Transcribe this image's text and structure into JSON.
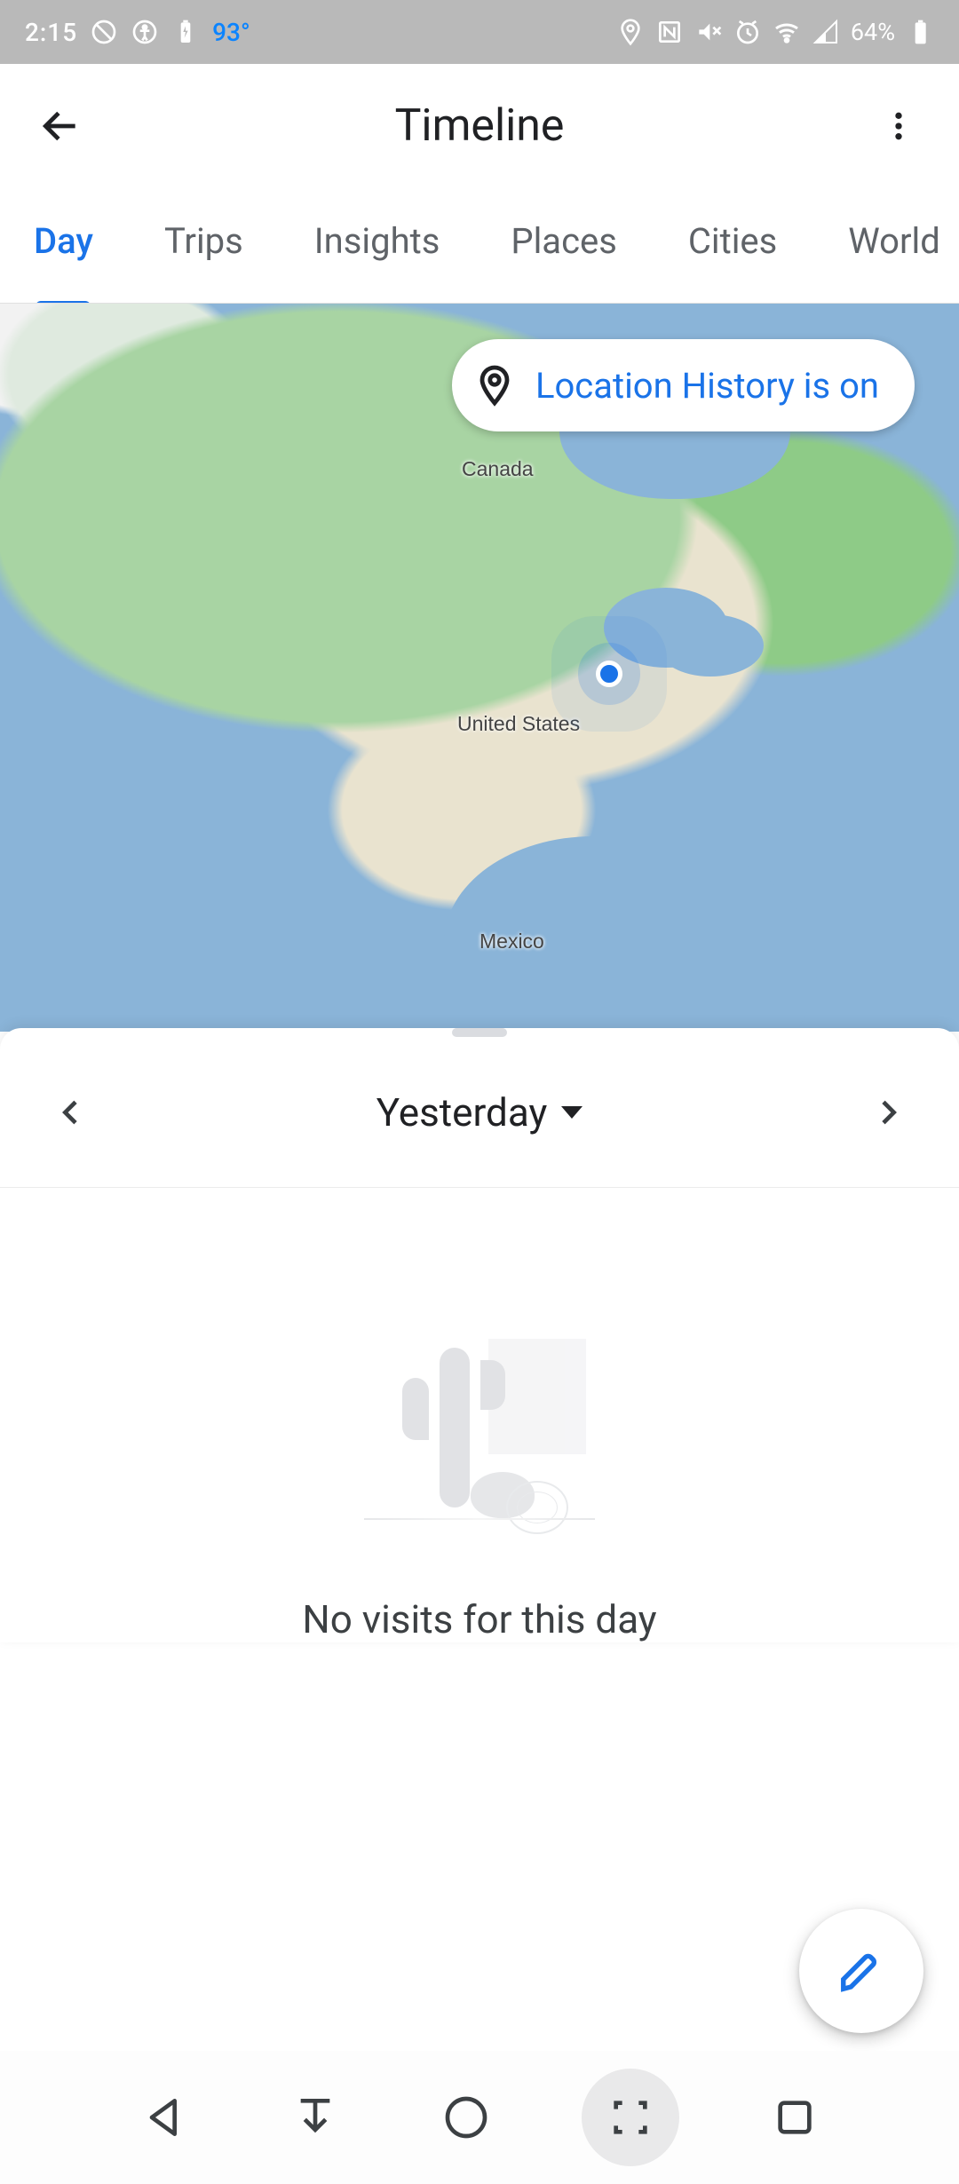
{
  "status_bar": {
    "time": "2:15",
    "temperature": "93°",
    "battery_pct": "64%"
  },
  "header": {
    "title": "Timeline"
  },
  "tabs": [
    {
      "label": "Day",
      "active": true
    },
    {
      "label": "Trips",
      "active": false
    },
    {
      "label": "Insights",
      "active": false
    },
    {
      "label": "Places",
      "active": false
    },
    {
      "label": "Cities",
      "active": false
    },
    {
      "label": "World",
      "active": false
    }
  ],
  "map": {
    "location_chip_text": "Location History is on",
    "labels": {
      "canada": "Canada",
      "us": "United States",
      "mexico": "Mexico"
    }
  },
  "date_selector": {
    "current": "Yesterday"
  },
  "empty_state": {
    "message": "No visits for this day"
  },
  "icons": {
    "back": "back-arrow-icon",
    "more": "more-vert-icon",
    "pin": "location-pin-icon",
    "prev": "chevron-left-icon",
    "next": "chevron-right-icon",
    "edit": "edit-pencil-icon",
    "nav_back": "nav-back-icon",
    "nav_down": "nav-download-icon",
    "nav_home": "nav-home-icon",
    "nav_screenshot": "nav-screenshot-icon",
    "nav_recent": "nav-recent-icon"
  }
}
